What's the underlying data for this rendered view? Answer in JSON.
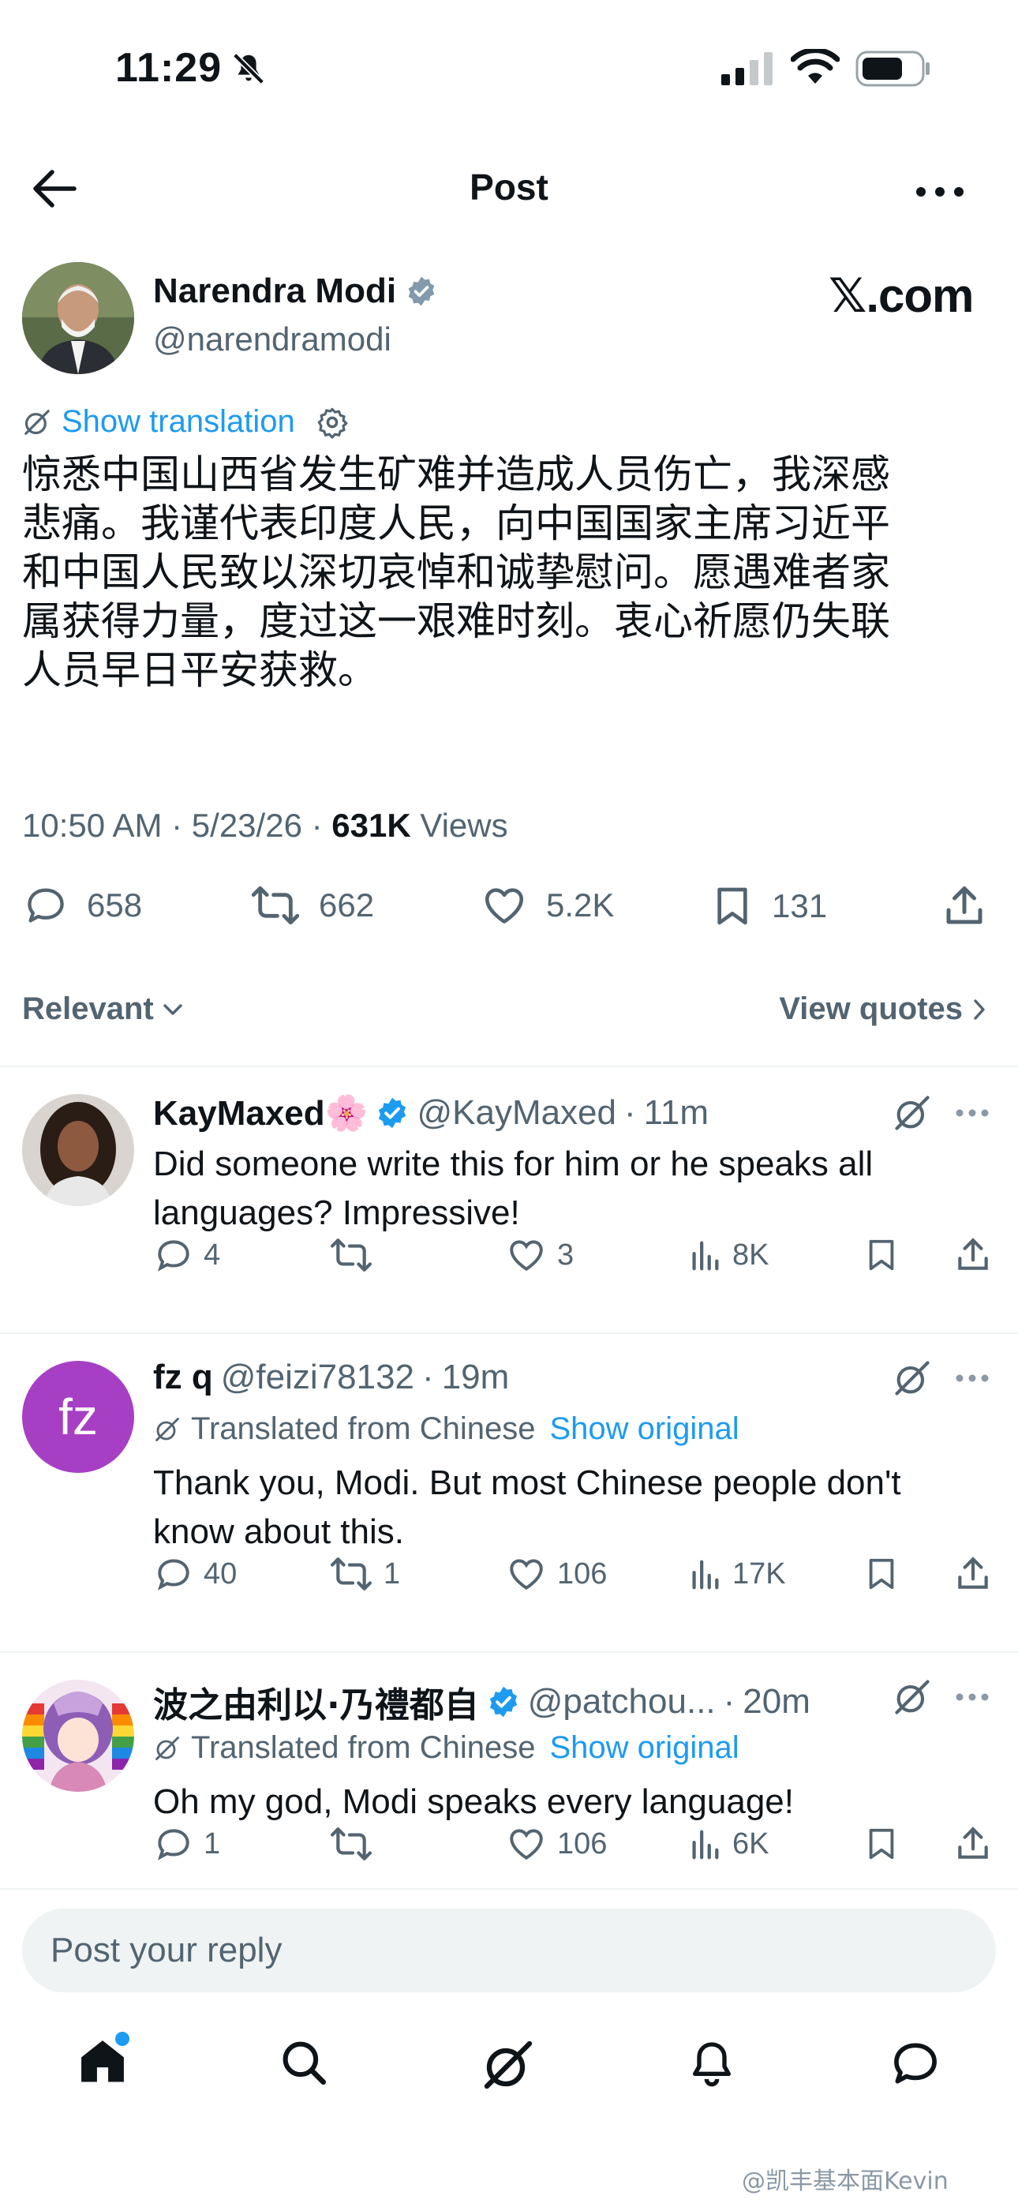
{
  "status_bar": {
    "time": "11:29"
  },
  "header": {
    "title": "Post"
  },
  "author": {
    "name": "Narendra Modi",
    "handle": "@narendramodi"
  },
  "watermark": "𝕏.com",
  "translation": {
    "label": "Show translation"
  },
  "post": {
    "lines": [
      "惊悉中国山西省发生矿难并造成人员伤亡，我深感",
      "悲痛。我谨代表印度人民，向中国国家主席习近平",
      "和中国人民致以深切哀悼和诚挚慰问。愿遇难者家",
      "属获得力量，度过这一艰难时刻。衷心祈愿仍失联",
      "人员早日平安获救。"
    ],
    "time": "10:50 AM",
    "date": "5/23/26",
    "views_count": "631K",
    "views_label": "Views",
    "stats": {
      "replies": "658",
      "reposts": "662",
      "likes": "5.2K",
      "bookmarks": "131"
    }
  },
  "filter": {
    "sort_label": "Relevant",
    "quotes_label": "View quotes"
  },
  "replies": [
    {
      "name": "KayMaxed🌸",
      "handle": "@KayMaxed",
      "time": "11m",
      "translated": null,
      "text": [
        "Did someone write this for him or he speaks all",
        "languages? Impressive!"
      ],
      "stats": {
        "replies": "4",
        "reposts": "",
        "likes": "3",
        "views": "8K"
      }
    },
    {
      "name": "fz q",
      "handle": "@feizi78132",
      "time": "19m",
      "translated_label": "Translated from Chinese",
      "show_original": "Show original",
      "text": [
        "Thank you, Modi. But most Chinese people don't",
        "know about this."
      ],
      "stats": {
        "replies": "40",
        "reposts": "1",
        "likes": "106",
        "views": "17K"
      },
      "avatar_initials": "fz"
    },
    {
      "name": "波之由利以·乃禮都自",
      "handle": "@patchou...",
      "time": "20m",
      "translated_label": "Translated from Chinese",
      "show_original": "Show original",
      "text": [
        "Oh my god, Modi speaks every language!"
      ],
      "stats": {
        "replies": "1",
        "reposts": "",
        "likes": "106",
        "views": "6K"
      }
    }
  ],
  "reply_input": {
    "placeholder": "Post your reply"
  },
  "bottom_nav": [
    "home-icon",
    "search-icon",
    "grok-icon",
    "notifications-icon",
    "messages-icon"
  ],
  "credit": "@凯丰基本面Kevin",
  "colors": {
    "accent": "#1d9bf0",
    "text": "#0f1419",
    "secondary": "#536471",
    "verified": "#1d9bf0"
  }
}
